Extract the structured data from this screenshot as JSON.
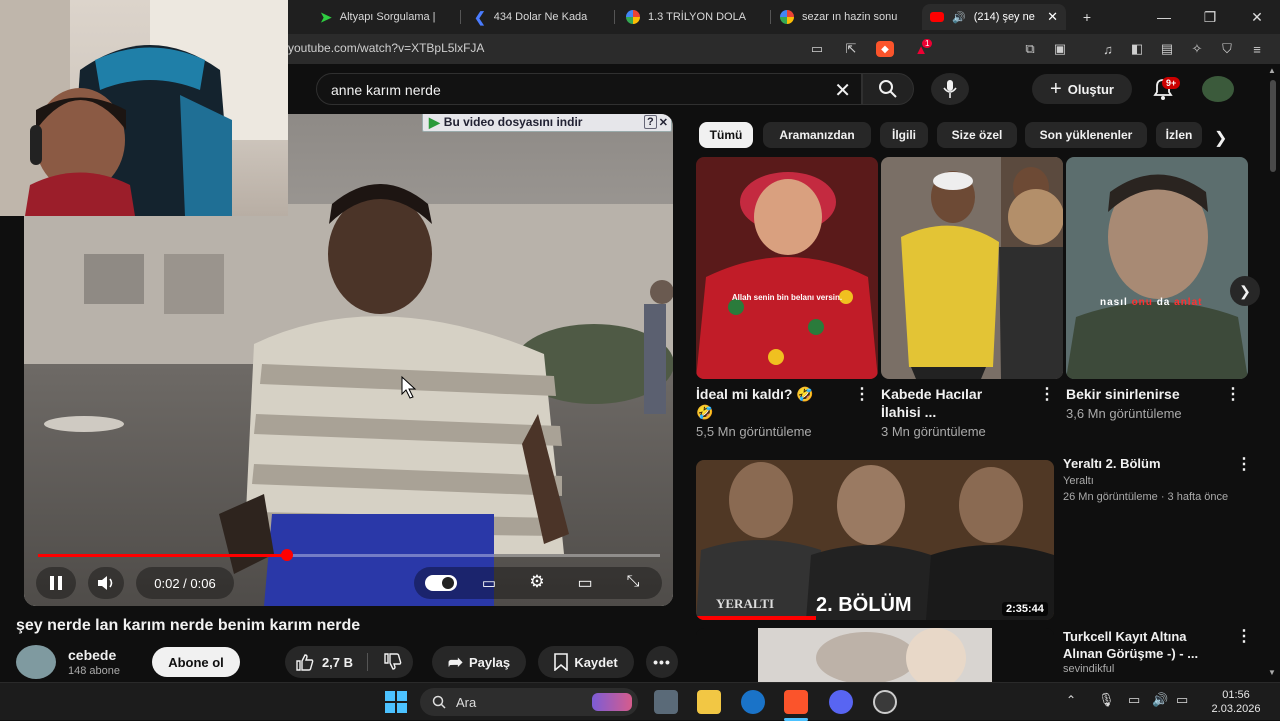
{
  "browser": {
    "tabs": [
      {
        "title": "Altyapı Sorgulama |",
        "icon_color": "#2ecc40"
      },
      {
        "title": "434 Dolar Ne Kada",
        "icon_color": "#4a7cff"
      },
      {
        "title": "1.3 TRİLYON DOLA",
        "icon_color": "#4285f4"
      },
      {
        "title": "sezar ın hazin sonu",
        "icon_color": "#4285f4"
      },
      {
        "title": "(214) şey ne",
        "icon_color": "#ff0000"
      }
    ],
    "new_tab": "+",
    "url": "youtube.com/watch?v=XTBpL5lxFJA",
    "brave_badge": "1"
  },
  "youtube": {
    "search_value": "anne karım nerde",
    "create_label": "Oluştur",
    "notif_badge": "9+"
  },
  "player": {
    "download_bar": "Bu video dosyasını indir",
    "time": "0:02 / 0:06",
    "progress": 0.4
  },
  "video": {
    "title": "şey nerde lan karım nerde benim karım nerde",
    "channel": "cebede",
    "subs": "148 abone",
    "subscribe": "Abone ol",
    "likes": "2,7 B",
    "share": "Paylaş",
    "save": "Kaydet"
  },
  "chips": [
    "Tümü",
    "Aramanızdan",
    "İlgili",
    "Size özel",
    "Son yüklenenler",
    "İzlen"
  ],
  "shorts": [
    {
      "title": "İdeal mi kaldı? 🤣",
      "title2": "🤣",
      "views": "5,5 Mn görüntüleme",
      "caption": "Allah senin bin belanı versin."
    },
    {
      "title": "Kabede Hacılar",
      "title2": "İlahisi ...",
      "views": "3 Mn görüntüleme",
      "caption": ""
    },
    {
      "title": "Bekir sinirlenirse",
      "title2": "",
      "views": "3,6 Mn görüntüleme",
      "caption_a": "nasıl",
      "caption_b": "onu",
      "caption_c": "da",
      "caption_d": "anlat"
    }
  ],
  "recs": [
    {
      "title": "Yeraltı 2. Bölüm",
      "channel": "Yeraltı",
      "meta": "26 Mn görüntüleme · 3 hafta önce",
      "duration": "2:35:44",
      "thumb_logo": "YERALTI",
      "thumb_ep": "2. BÖLÜM"
    },
    {
      "title": "Turkcell Kayıt Altına",
      "title2": "Alınan Görüşme -) - ...",
      "channel": "sevindikful"
    }
  ],
  "taskbar": {
    "search": "Ara",
    "time": "01:56",
    "date": "2.03.2026"
  }
}
